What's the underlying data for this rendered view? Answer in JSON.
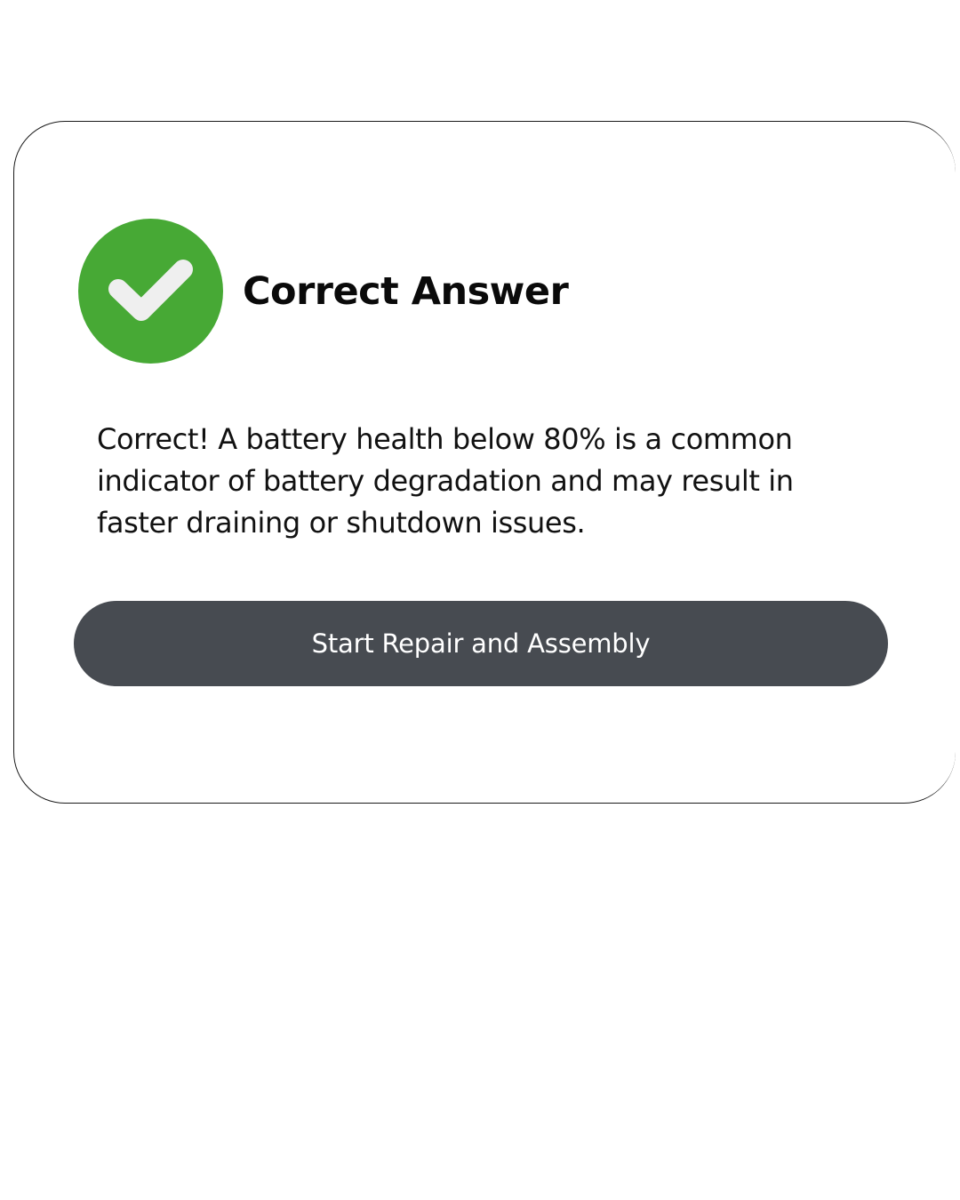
{
  "card": {
    "title": "Correct Answer",
    "status_icon": "check-circle-icon",
    "message": "Correct! A battery health below 80% is a common indicator of battery degradation and may result in faster draining or shutdown issues.",
    "button_label": "Start Repair and Assembly"
  },
  "colors": {
    "success_green": "#47a935",
    "check_mark": "#efefef",
    "button_bg": "#474b51",
    "button_text": "#ffffff"
  }
}
